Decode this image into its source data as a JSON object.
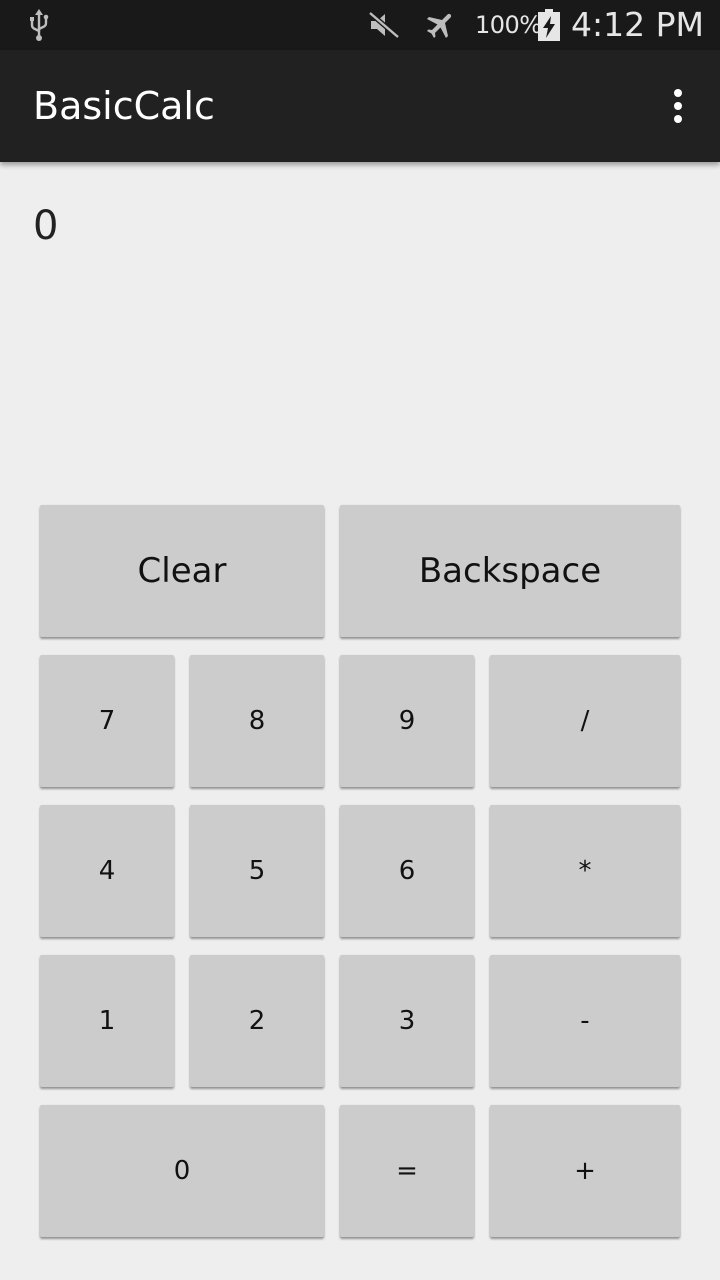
{
  "status_bar": {
    "icons": [
      "usb-icon",
      "mute-icon",
      "airplane-icon",
      "battery-charging-icon"
    ],
    "battery_percent": "100%",
    "time": "4:12 PM"
  },
  "app_bar": {
    "title": "BasicCalc",
    "overflow_icon": "more-vert-icon"
  },
  "display": {
    "value": "0"
  },
  "keypad": {
    "clear": "Clear",
    "backspace": "Backspace",
    "k7": "7",
    "k8": "8",
    "k9": "9",
    "divide": "/",
    "k4": "4",
    "k5": "5",
    "k6": "6",
    "multiply": "*",
    "k1": "1",
    "k2": "2",
    "k3": "3",
    "minus": "-",
    "k0": "0",
    "equals": "=",
    "plus": "+"
  },
  "colors": {
    "status_bar_bg": "#191919",
    "app_bar_bg": "#212121",
    "background": "#eeeeee",
    "key_bg": "#cccccc"
  }
}
